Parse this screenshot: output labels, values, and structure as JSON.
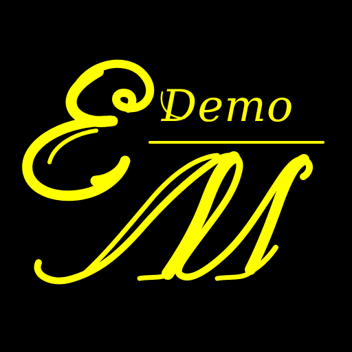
{
  "app_icon": {
    "monogram_letters": "EM",
    "label": "Demo",
    "colors": {
      "background": "#000000",
      "foreground": "#FFFF00"
    }
  }
}
